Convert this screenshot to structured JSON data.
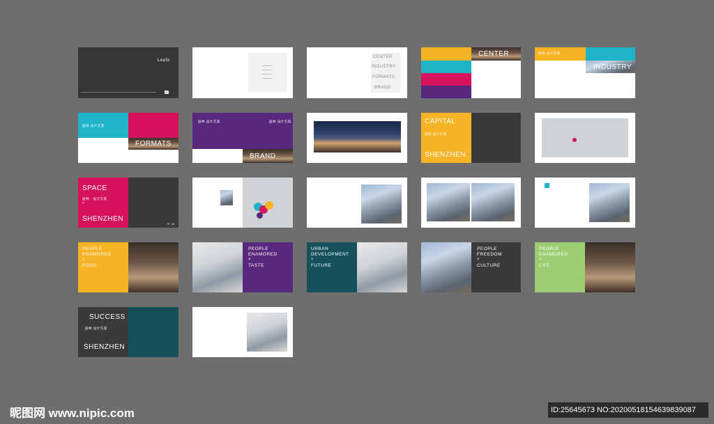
{
  "pages": {
    "p01": {
      "logo": "Leafo"
    },
    "p04": {
      "title": "CENTER"
    },
    "p05": {
      "title": "INDUSTRY",
      "label": "园林 设计方案"
    },
    "p06": {
      "title": "FORMATS",
      "label": "园林 设计方案"
    },
    "p07": {
      "title": "BRAND",
      "label_left": "园林 设计方案",
      "label_right": "园林 设计方案"
    },
    "p09": {
      "title1": "CAPITAL",
      "sub": "园林 设计方案",
      "title2": "SHENZHEN"
    },
    "p11": {
      "title1": "SPACE",
      "sub": "园林 · 设计方案",
      "x": "×",
      "title2": "SHENZHEN",
      "num": "© 10"
    },
    "p16": {
      "l1": "PEOPLE",
      "l2": "ENAMORED",
      "x": "×",
      "l3": "FOOD"
    },
    "p17": {
      "l1": "PEOPLE",
      "l2": "ENAMORED",
      "x": "×",
      "l3": "TASTE"
    },
    "p18": {
      "l1": "URBAN",
      "l2": "DEVELOPMENT",
      "x": "+",
      "l3": "FUTURE"
    },
    "p19": {
      "l1": "PEOPLE",
      "l2": "FREEDOM",
      "x": "×",
      "l3": "CULTURE"
    },
    "p20": {
      "l1": "PEOPLE",
      "l2": "ENAMORED",
      "x": "×",
      "l3": "LIFE"
    },
    "p21": {
      "title1": "SUCCESS",
      "sub": "园林 设计方案",
      "title2": "SHENZHEN"
    },
    "p03": {
      "w1": "CENTER",
      "w2": "INDUSTRY",
      "w3": "FORMATS",
      "w4": "BRAND",
      "x": "×"
    }
  },
  "watermark": {
    "site": "昵图网 www.nipic.com",
    "id": "ID:25645673 NO:20200518154639839087"
  },
  "colors": {
    "bg": "#6e6e6e",
    "yellow": "#f6b324",
    "cyan": "#1fb3c9",
    "magenta": "#d7125d",
    "purple": "#58287c",
    "dark": "#3a3a3a",
    "teal": "#15515a",
    "green": "#9ccd72"
  }
}
